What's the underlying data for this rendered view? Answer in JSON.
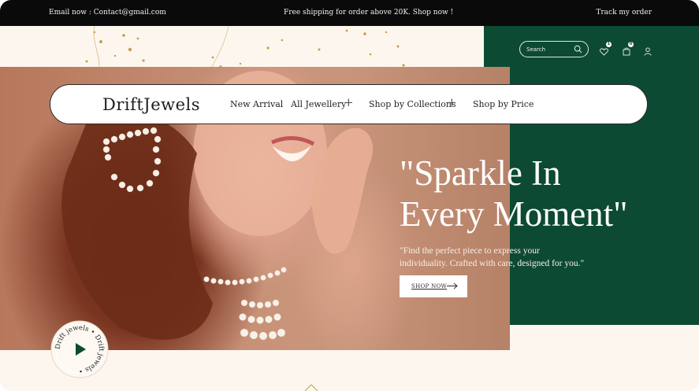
{
  "topbar": {
    "email": "Email now : Contact@gmail.com",
    "shipping": "Free shipping for order above 20K. Shop now !",
    "track": "Track my order"
  },
  "header": {
    "search_placeholder": "Search",
    "wishlist_count": "1",
    "cart_count": "0"
  },
  "nav": {
    "logo": "DriftJewels",
    "items": [
      "New Arrival",
      "All Jewellery",
      "Shop by Collections",
      "Shop by Price"
    ],
    "expand_icon": "plus-icon"
  },
  "hero": {
    "headline_line1": "\"Sparkle In",
    "headline_line2": "Every Moment\"",
    "subtext": "\"Find the perfect piece to express your individuality. Crafted with care, designed for you.\"",
    "cta": "SHOP NOW"
  },
  "badge": {
    "circle_text": "Drift jewels • Drift jewels •"
  },
  "colors": {
    "topbar": "#0a0a0a",
    "green": "#0c4a33",
    "cream": "#fcf6ef",
    "white": "#ffffff"
  }
}
